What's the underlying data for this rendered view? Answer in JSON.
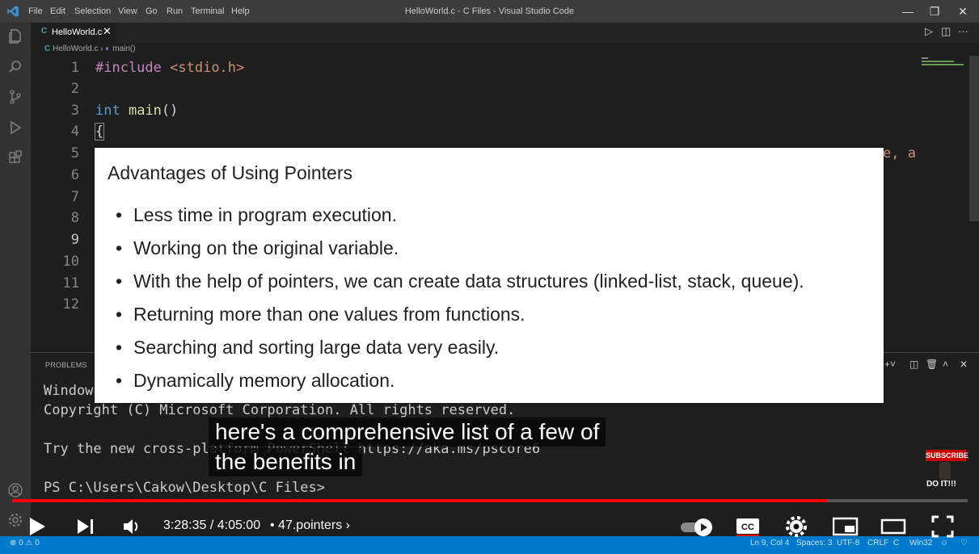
{
  "window": {
    "title": "HelloWorld.c - C Files - Visual Studio Code",
    "menu": [
      "File",
      "Edit",
      "Selection",
      "View",
      "Go",
      "Run",
      "Terminal",
      "Help"
    ]
  },
  "tab": {
    "label": "HelloWorld.c",
    "lang_icon": "C"
  },
  "breadcrumb": {
    "file": "HelloWorld.c",
    "symbol": "main()"
  },
  "editor": {
    "line_numbers": [
      "1",
      "2",
      "3",
      "4",
      "5",
      "6",
      "7",
      "8",
      "9",
      "10",
      "11",
      "12"
    ],
    "include_keyword": "#include",
    "include_header": "<stdio.h>",
    "int_keyword": "int",
    "main_func": "main",
    "parens": "()",
    "brace": "{",
    "partial_right": "e, a"
  },
  "panel": {
    "problems_tab": "PROBLEMS",
    "terminal_lines": [
      "Window",
      "Copyright (C) Microsoft Corporation. All rights reserved.",
      "",
      "Try the new cross-platform PowerShell https://aka.ms/pscore6",
      "",
      "PS C:\\Users\\Cakow\\Desktop\\C Files>"
    ]
  },
  "slide": {
    "title": "Advantages of Using Pointers",
    "items": [
      "Less time in program execution.",
      "Working on the original variable.",
      "With the help of pointers, we can create data structures (linked-list, stack, queue).",
      "Returning more than one values from functions.",
      "Searching and sorting large data very easily.",
      "Dynamically memory allocation."
    ]
  },
  "captions": {
    "line1": "here's a comprehensive list of a few of",
    "line2": "the benefits in"
  },
  "player": {
    "time": "3:28:35 / 4:05:00",
    "chapter": "• 47.pointers",
    "progress": 0.853,
    "cc_label": "CC"
  },
  "branding": {
    "subscribe": "SUBSCRIBE",
    "doit": "DO IT!!!"
  },
  "statusbar": {
    "errors": "⊗ 0 ⚠ 0",
    "position": "Ln 9, Col 4",
    "spaces": "Spaces: 3",
    "encoding": "UTF-8",
    "eol": "CRLF",
    "language": "C",
    "platform": "Win32"
  },
  "colors": {
    "accent": "#007acc",
    "progress": "#ff0000",
    "keyword": "#569cd6",
    "string": "#ce9178",
    "preproc": "#c586c0",
    "func": "#dcdcaa"
  }
}
